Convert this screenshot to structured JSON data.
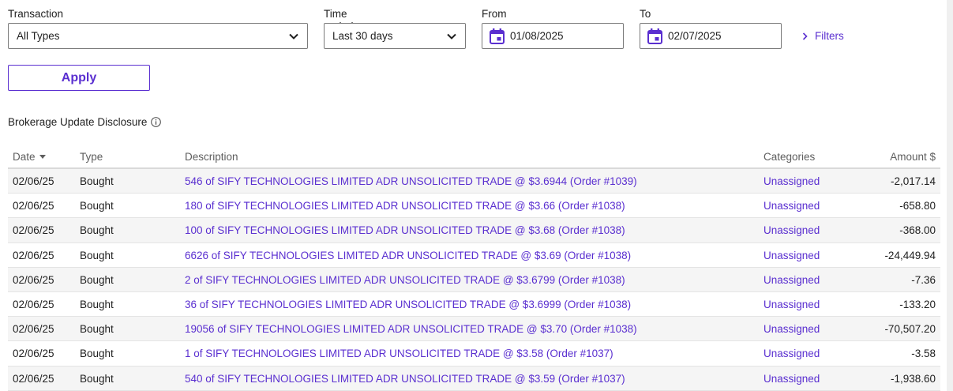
{
  "filters": {
    "transaction": {
      "label": "Transaction",
      "value": "All Types"
    },
    "time_period": {
      "label": "Time period",
      "value": "Last 30 days"
    },
    "from": {
      "label": "From",
      "value": "01/08/2025"
    },
    "to": {
      "label": "To",
      "value": "02/07/2025"
    },
    "filters_link": "Filters",
    "apply_label": "Apply"
  },
  "disclosure": "Brokerage Update Disclosure",
  "table": {
    "headers": {
      "date": "Date",
      "type": "Type",
      "description": "Description",
      "categories": "Categories",
      "amount": "Amount $"
    },
    "rows": [
      {
        "date": "02/06/25",
        "type": "Bought",
        "description": "546 of SIFY TECHNOLOGIES LIMITED ADR UNSOLICITED TRADE @ $3.6944 (Order #1039)",
        "category": "Unassigned",
        "amount": "-2,017.14"
      },
      {
        "date": "02/06/25",
        "type": "Bought",
        "description": "180 of SIFY TECHNOLOGIES LIMITED ADR UNSOLICITED TRADE @ $3.66 (Order #1038)",
        "category": "Unassigned",
        "amount": "-658.80"
      },
      {
        "date": "02/06/25",
        "type": "Bought",
        "description": "100 of SIFY TECHNOLOGIES LIMITED ADR UNSOLICITED TRADE @ $3.68 (Order #1038)",
        "category": "Unassigned",
        "amount": "-368.00"
      },
      {
        "date": "02/06/25",
        "type": "Bought",
        "description": "6626 of SIFY TECHNOLOGIES LIMITED ADR UNSOLICITED TRADE @ $3.69 (Order #1038)",
        "category": "Unassigned",
        "amount": "-24,449.94"
      },
      {
        "date": "02/06/25",
        "type": "Bought",
        "description": "2 of SIFY TECHNOLOGIES LIMITED ADR UNSOLICITED TRADE @ $3.6799 (Order #1038)",
        "category": "Unassigned",
        "amount": "-7.36"
      },
      {
        "date": "02/06/25",
        "type": "Bought",
        "description": "36 of SIFY TECHNOLOGIES LIMITED ADR UNSOLICITED TRADE @ $3.6999 (Order #1038)",
        "category": "Unassigned",
        "amount": "-133.20"
      },
      {
        "date": "02/06/25",
        "type": "Bought",
        "description": "19056 of SIFY TECHNOLOGIES LIMITED ADR UNSOLICITED TRADE @ $3.70 (Order #1038)",
        "category": "Unassigned",
        "amount": "-70,507.20"
      },
      {
        "date": "02/06/25",
        "type": "Bought",
        "description": "1 of SIFY TECHNOLOGIES LIMITED ADR UNSOLICITED TRADE @ $3.58 (Order #1037)",
        "category": "Unassigned",
        "amount": "-3.58"
      },
      {
        "date": "02/06/25",
        "type": "Bought",
        "description": "540 of SIFY TECHNOLOGIES LIMITED ADR UNSOLICITED TRADE @ $3.59 (Order #1037)",
        "category": "Unassigned",
        "amount": "-1,938.60"
      }
    ]
  },
  "icons": {
    "chevron": "chevron-down-icon",
    "calendar": "calendar-icon",
    "filters": "chevron-right-icon",
    "info": "info-icon",
    "sort": "sort-desc-icon"
  },
  "colors": {
    "accent": "#5a2fd0",
    "row_alt": "#f5f5f5"
  }
}
